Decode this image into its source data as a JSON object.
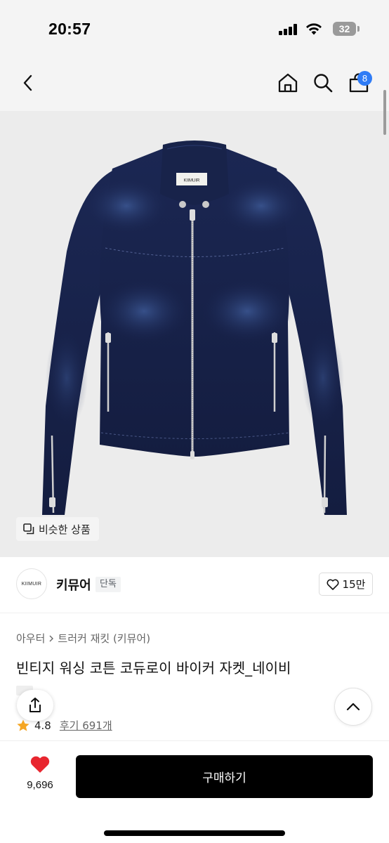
{
  "status_bar": {
    "time": "20:57",
    "battery": "32"
  },
  "nav": {
    "back_icon": "chevron-left-icon",
    "home_icon": "home-icon",
    "search_icon": "search-icon",
    "cart_icon": "shopping-bag-icon",
    "cart_count": "8"
  },
  "product_image": {
    "label_on_garment": "KIIMUIR",
    "similar_button_label": "비슷한 상품"
  },
  "brand": {
    "logo_text": "KIIMUIR",
    "name": "키뮤어",
    "tag": "단독",
    "like_count": "15만"
  },
  "product": {
    "breadcrumb": [
      "아우터",
      "트러커 재킷 (키뮤어)"
    ],
    "title": "빈티지 워싱 코튼 코듀로이 바이커 자켓_네이비",
    "rating": "4.8",
    "review_label": "후기 691개"
  },
  "bottom": {
    "wish_count": "9,696",
    "buy_label": "구매하기"
  },
  "colors": {
    "accent_badge": "#2f7cf6",
    "heart": "#e8262f",
    "star": "#f5a623",
    "buy_button": "#000000"
  }
}
